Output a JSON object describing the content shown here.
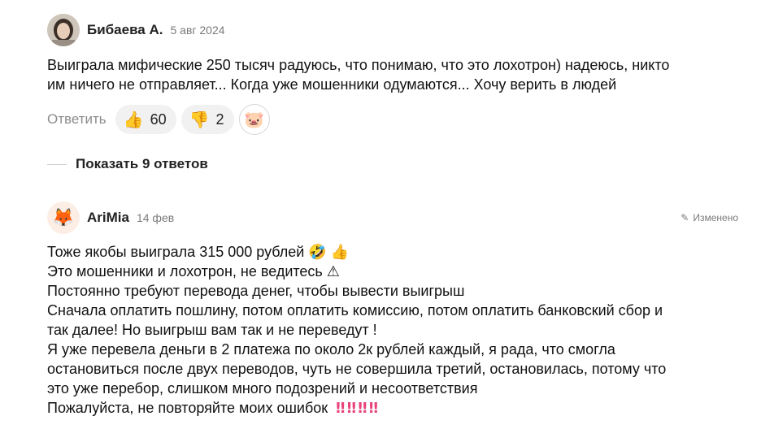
{
  "comments": [
    {
      "author": "Бибаева А.",
      "date": "5 авг 2024",
      "avatar_icon": "user-photo",
      "text_lines": [
        "Выиграла мифические 250 тысяч радуюсь, что понимаю, что это лохотрон) надеюсь, никто",
        "им ничего не отправляет... Когда уже мошенники одумаются... Хочу верить в людей"
      ],
      "reply_label": "Ответить",
      "likes": "60",
      "dislikes": "2",
      "like_icon": "👍",
      "dislike_icon": "👎",
      "reaction_icon": "🐷"
    },
    {
      "author": "AriMia",
      "date": "14 фев",
      "avatar_icon": "🦊",
      "edited_label": "Изменено",
      "edit_icon": "✎",
      "text_lines": [
        "Тоже якобы выиграла 315 000 рублей 🤣 👍",
        "Это мошенники и лохотрон, не ведитесь ⚠",
        "Постоянно требуют перевода денег, чтобы вывести выигрыш",
        "Сначала оплатить пошлину, потом оплатить комиссию, потом оплатить банковский сбор и",
        "так далее! Но выигрыш вам так и не переведут !",
        "Я уже перевела деньги в 2 платежа по около 2к рублей каждый, я рада, что смогла",
        "остановиться после двух переводов, чуть не совершила третий, остановилась, потому что",
        "это уже перебор, слишком много подозрений и несоответствия",
        "Пожалуйста, не повторяйте моих ошибок"
      ],
      "last_line_emphasis": "‼ ‼ ‼ ‼"
    }
  ],
  "show_replies_label": "Показать 9 ответов",
  "colors": {
    "muted": "#8c8c8c",
    "pill_bg": "#f1f1f1",
    "accent_bang": "#e8447a"
  }
}
